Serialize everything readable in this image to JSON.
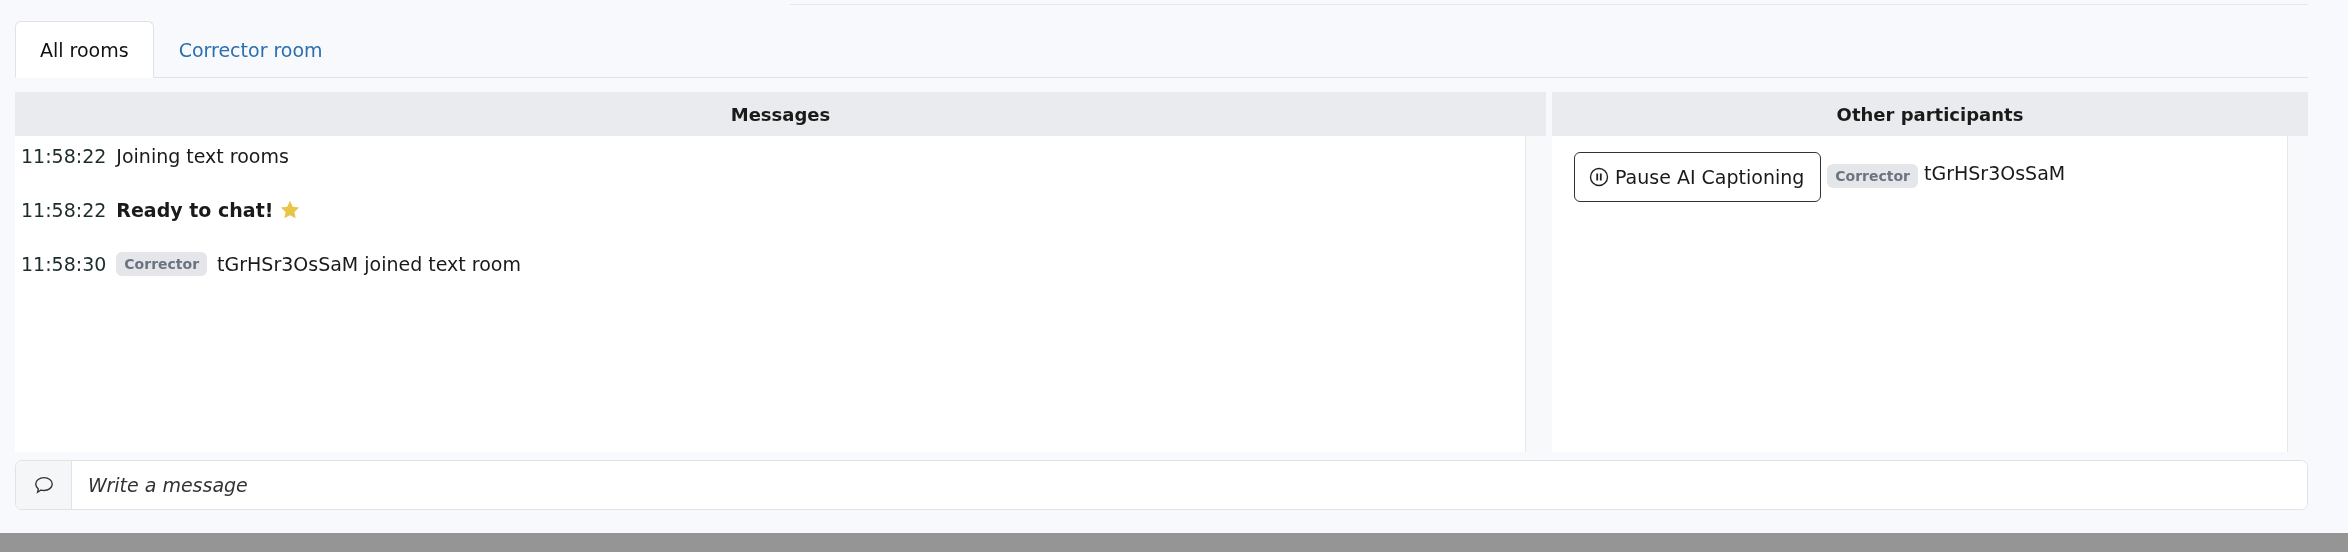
{
  "tabs": [
    {
      "label": "All rooms",
      "selected": true
    },
    {
      "label": "Corrector room",
      "selected": false
    }
  ],
  "messages_panel": {
    "title": "Messages",
    "messages": [
      {
        "time": "11:58:22",
        "kind": "plain",
        "text": "Joining text rooms"
      },
      {
        "time": "11:58:22",
        "kind": "bold",
        "text": "Ready to chat!",
        "star": true
      },
      {
        "time": "11:58:30",
        "kind": "join",
        "badge": "Corrector",
        "text": "tGrHSr3OsSaM joined text room"
      }
    ]
  },
  "participants_panel": {
    "title": "Other participants",
    "pause_button": "Pause AI Captioning",
    "participants": [
      {
        "badge": "Corrector",
        "name": "tGrHSr3OsSaM"
      }
    ]
  },
  "composer": {
    "placeholder": "Write a message"
  }
}
